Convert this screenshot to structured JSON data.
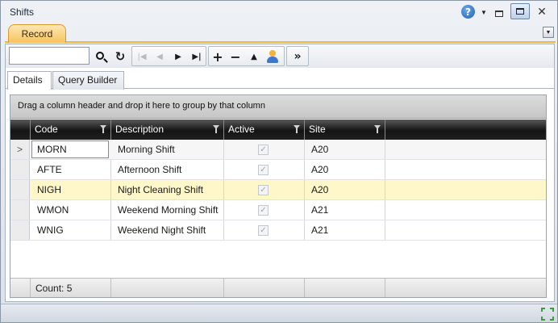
{
  "window": {
    "title": "Shifts"
  },
  "tabstrip": {
    "record_tab": "Record"
  },
  "toolbar": {
    "search_value": ""
  },
  "subtabs": {
    "details": "Details",
    "query_builder": "Query Builder"
  },
  "grid": {
    "group_panel_text": "Drag a column header and drop it here to group by that column",
    "columns": [
      "Code",
      "Description",
      "Active",
      "Site"
    ],
    "rows": [
      {
        "code": "MORN",
        "description": "Morning Shift",
        "active": true,
        "site": "A20"
      },
      {
        "code": "AFTE",
        "description": "Afternoon Shift",
        "active": true,
        "site": "A20"
      },
      {
        "code": "NIGH",
        "description": "Night Cleaning Shift",
        "active": true,
        "site": "A20"
      },
      {
        "code": "WMON",
        "description": "Weekend Morning Shift",
        "active": true,
        "site": "A21"
      },
      {
        "code": "WNIG",
        "description": "Weekend Night Shift",
        "active": true,
        "site": "A21"
      }
    ],
    "footer_count": "Count: 5",
    "current_row_marker": ">"
  },
  "colors": {
    "record_tab": "#f6c35d",
    "selected_row": "#fdf7c9",
    "header_bg": "#141414"
  },
  "icons": [
    "help-icon",
    "dropdown-arrow-icon",
    "minimize-icon",
    "restore-icon",
    "close-icon",
    "search-icon",
    "refresh-icon",
    "first-record-icon",
    "previous-record-icon",
    "next-record-icon",
    "last-record-icon",
    "add-icon",
    "remove-icon",
    "move-up-icon",
    "users-icon",
    "more-icon",
    "filter-icon",
    "resize-grip-icon"
  ]
}
